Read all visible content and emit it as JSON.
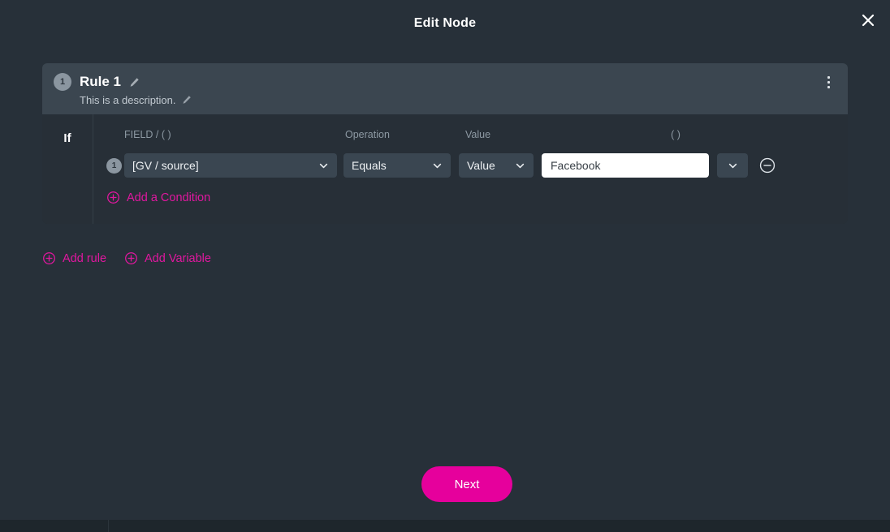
{
  "modal": {
    "title": "Edit Node",
    "close_icon": "close-icon"
  },
  "rule": {
    "number": "1",
    "name": "Rule 1",
    "description": "This is a description.",
    "edit_icon": "pencil-icon",
    "menu_icon": "kebab-menu-icon"
  },
  "conditions_section": {
    "if_label": "If",
    "headers": {
      "field": "FIELD / ( )",
      "operation": "Operation",
      "value": "Value",
      "parenthesis": "( )"
    },
    "rows": [
      {
        "number": "1",
        "field": "[GV / source]",
        "operation": "Equals",
        "value_type": "Value",
        "value": "Facebook",
        "value_placeholder": "",
        "parenthesis": "",
        "remove_icon": "minus-circle-icon"
      }
    ],
    "add_condition_label": "Add a Condition",
    "add_condition_icon": "plus-circle-icon"
  },
  "actions": {
    "add_rule_label": "Add rule",
    "add_variable_label": "Add Variable",
    "add_icon": "plus-circle-icon",
    "next_label": "Next"
  },
  "colors": {
    "accent": "#e0179f",
    "next_button": "#e6009c",
    "modal_bg": "#273039",
    "rule_header_bg": "#3b4650",
    "control_bg": "#3a4651",
    "input_bg": "#ffffff"
  }
}
